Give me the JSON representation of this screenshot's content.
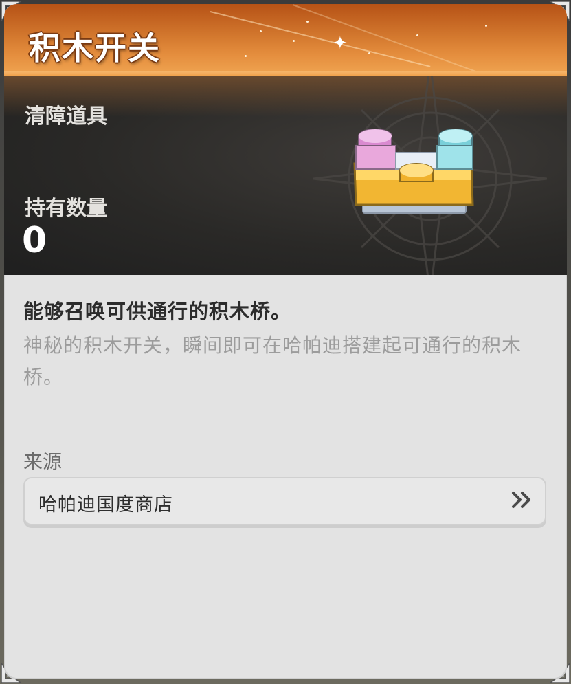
{
  "item": {
    "name": "积木开关",
    "category": "清障道具",
    "quantity_label": "持有数量",
    "quantity_value": "0",
    "art_icon": "toy-brick-switch-icon"
  },
  "description": {
    "title": "能够召唤可供通行的积木桥。",
    "body": "神秘的积木开关，瞬间即可在哈帕迪搭建起可通行的积木桥。"
  },
  "source": {
    "label": "来源",
    "entries": [
      {
        "label": "哈帕迪国度商店",
        "arrow_icon": "double-chevron-right-icon"
      }
    ]
  },
  "colors": {
    "header_orange": "#e48d3d",
    "dark_band": "#2a2927",
    "card_bg": "#e3e3e3"
  }
}
